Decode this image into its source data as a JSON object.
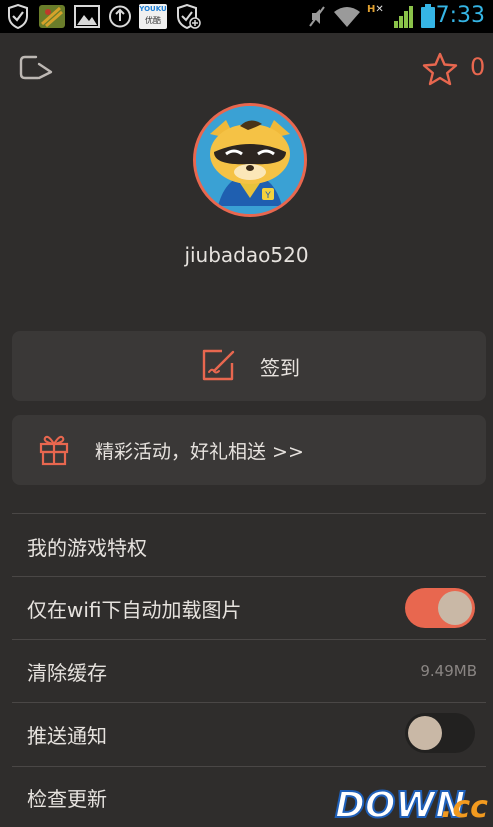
{
  "status_bar": {
    "time": "7:33",
    "icons": [
      "shield-check-icon",
      "game-app-icon",
      "image-icon",
      "sync-icon",
      "youku-app-icon",
      "shield-plus-icon",
      "mute-icon",
      "wifi-icon",
      "hx-icon",
      "signal-icon",
      "battery-icon"
    ],
    "youku_top": "YOUKU",
    "youku_bottom": "优酷",
    "hx": "H"
  },
  "header": {
    "favorites_count": "0"
  },
  "profile": {
    "username": "jiubadao520"
  },
  "checkin": {
    "label": "签到"
  },
  "promo": {
    "label": "精彩活动，好礼相送 >>"
  },
  "settings": {
    "privileges": "我的游戏特权",
    "wifi_images": "仅在wifi下自动加载图片",
    "wifi_images_enabled": true,
    "clear_cache": "清除缓存",
    "cache_size": "9.49MB",
    "push": "推送通知",
    "push_enabled": false,
    "check_update": "检查更新"
  },
  "watermark": {
    "text_main": "DOWN",
    "text_suffix": ".cc"
  },
  "colors": {
    "accent": "#e8674f",
    "background": "#2f2d2c",
    "card": "#3a3837",
    "clock": "#35b5e5"
  }
}
